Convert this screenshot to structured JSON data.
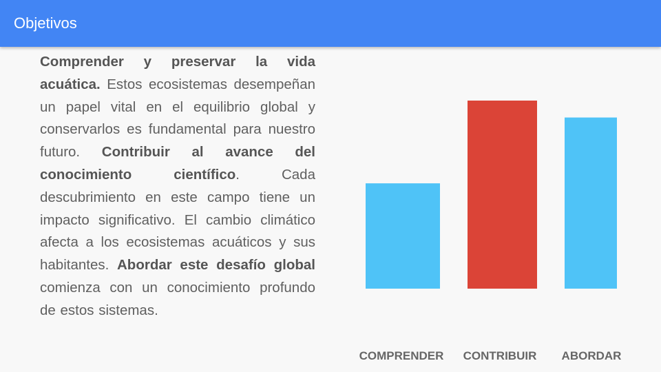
{
  "header": {
    "title": "Objetivos"
  },
  "body": {
    "bold1": "Comprender y preservar la vida acuática.",
    "text1": " Estos ecosistemas desempeñan un papel vital en el equilibrio global y conservarlos es fundamental para nuestro futuro. ",
    "bold2": "Contribuir al avance del conocimiento científico",
    "text2": ". Cada descubrimiento en este campo tiene un impacto significativo. El cambio climático afecta a los ecosistemas acuáticos y sus habitantes. ",
    "bold3": "Abordar este desafío global",
    "text3": " comienza con un conocimiento profundo de estos sistemas."
  },
  "chart_data": {
    "type": "bar",
    "categories": [
      "COMPRENDER",
      "CONTRIBUIR",
      "ABORDAR"
    ],
    "values": [
      56,
      100,
      91
    ],
    "colors": [
      "#4fc3f7",
      "#db4437",
      "#4fc3f7"
    ],
    "title": "",
    "xlabel": "",
    "ylabel": "",
    "ylim": [
      0,
      100
    ],
    "grid": false,
    "y_axis_shown": false
  }
}
